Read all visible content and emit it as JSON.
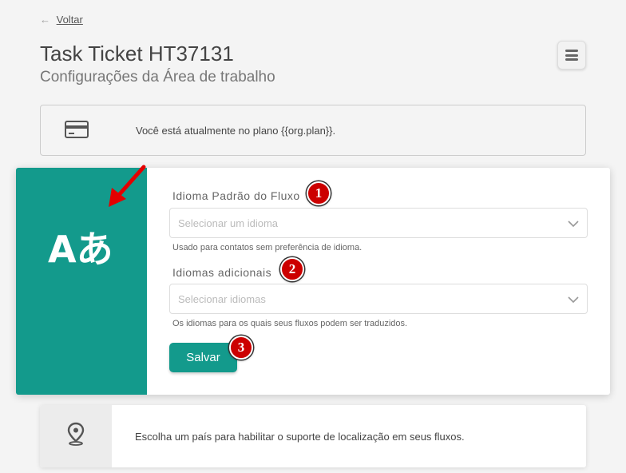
{
  "nav": {
    "back_arrow": "←",
    "back_label": "Voltar"
  },
  "header": {
    "title": "Task Ticket HT37131",
    "subtitle": "Configurações da Área de trabalho",
    "menu_icon": "hamburger-icon"
  },
  "plan": {
    "icon": "credit-card-icon",
    "text": "Você está atualmente no plano {{org.plan}}."
  },
  "language": {
    "icon": "translate-icon",
    "icon_text": "Aあ",
    "default_label": "Idioma Padrão do Fluxo",
    "default_placeholder": "Selecionar um idioma",
    "default_help": "Usado para contatos sem preferência de idioma.",
    "additional_label": "Idiomas adicionais",
    "additional_placeholder": "Selecionar idiomas",
    "additional_help": "Os idiomas para os quais seus fluxos podem ser traduzidos.",
    "save_label": "Salvar"
  },
  "badges": [
    "1",
    "2",
    "3"
  ],
  "location": {
    "icon": "location-pin-icon",
    "text": "Escolha um país para habilitar o suporte de localização em seus fluxos."
  },
  "colors": {
    "accent": "#139a8c",
    "badge": "#cc0000",
    "arrow": "#e30000"
  }
}
